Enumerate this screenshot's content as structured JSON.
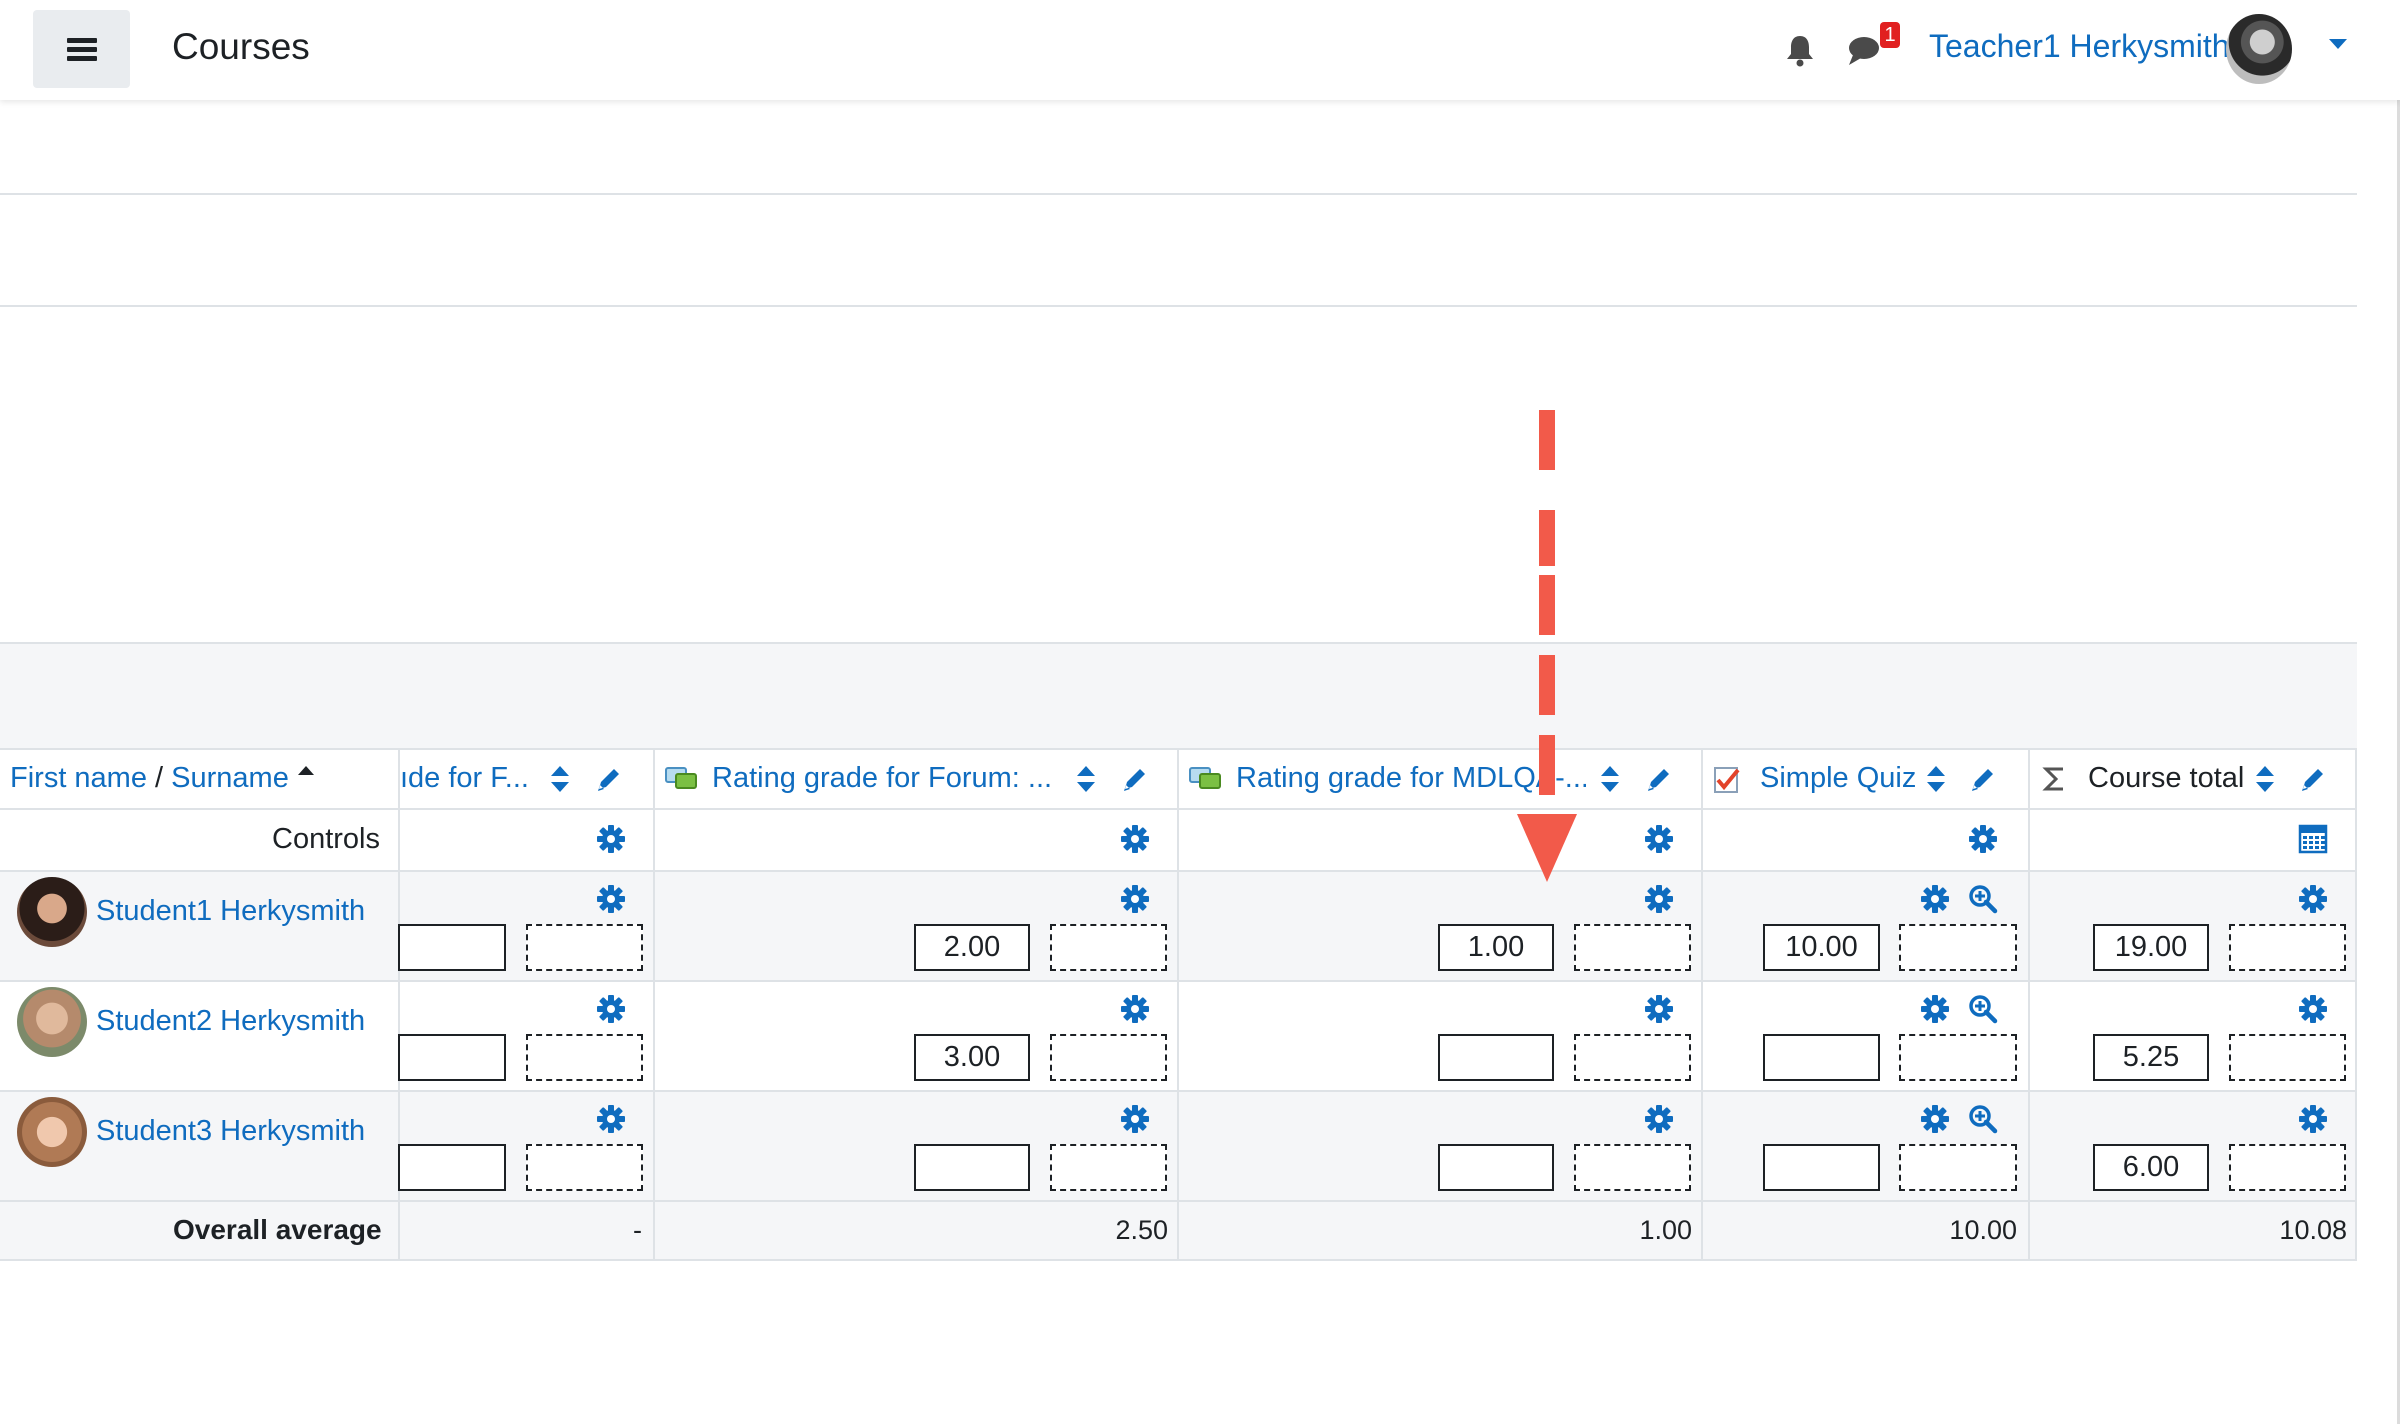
{
  "navbar": {
    "menu_icon": "hamburger-menu-icon",
    "title": "Courses",
    "notification_icon": "bell-icon",
    "messages_icon": "chat-bubble-icon",
    "messages_count": "1",
    "user_name": "Teacher1 Herkysmith"
  },
  "grader": {
    "headers": {
      "first_name": "First name",
      "separator": "/",
      "surname": "Surname",
      "col1": "ıde for F...",
      "col2": "Rating grade for Forum: ...",
      "col3": "Rating grade for MDLQA-...",
      "col4": "Simple Quiz",
      "col5": "Course total"
    },
    "controls_label": "Controls",
    "students": [
      {
        "name": "Student1 Herkysmith",
        "grades": [
          "",
          "2.00",
          "1.00",
          "10.00",
          "19.00"
        ]
      },
      {
        "name": "Student2 Herkysmith",
        "grades": [
          "",
          "3.00",
          "",
          "",
          "5.25"
        ]
      },
      {
        "name": "Student3 Herkysmith",
        "grades": [
          "",
          "",
          "",
          "",
          "6.00"
        ]
      }
    ],
    "overall_label": "Overall average",
    "averages": [
      "-",
      "2.50",
      "1.00",
      "10.00",
      "10.08"
    ]
  },
  "annotation": {
    "arrow_color": "#f25a4a",
    "arrow_style": "dashed-down-arrow"
  },
  "colors": {
    "link": "#0f6cbf",
    "header_bg": "#f5f6f8",
    "badge": "#e12020"
  }
}
